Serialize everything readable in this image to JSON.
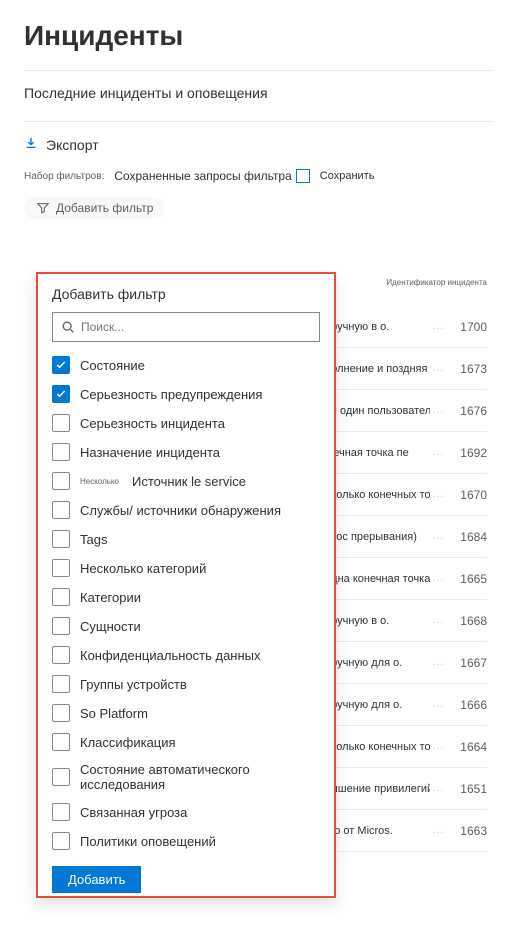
{
  "page": {
    "title": "Инциденты",
    "section": "Последние инциденты и оповещения",
    "export": "Экспорт",
    "filter_set_label": "Набор фильтров:",
    "saved_queries": "Сохраненные запросы фильтра",
    "save": "Сохранить",
    "add_filter": "Добавить фильтр"
  },
  "popup": {
    "title": "Добавить фильтр",
    "search_placeholder": "Поиск...",
    "add_button": "Добавить",
    "options": [
      {
        "label": "Состояние",
        "checked": true
      },
      {
        "label": "Серьезность предупреждения",
        "checked": true
      },
      {
        "label": "Серьезность инцидента",
        "checked": false
      },
      {
        "label": "Назначение инцидента",
        "checked": false
      },
      {
        "label": "Источник le service",
        "checked": false,
        "prefix": "Несколько"
      },
      {
        "label": "Службы/ источники обнаружения",
        "checked": false
      },
      {
        "label": "Tags",
        "checked": false
      },
      {
        "label": "Несколько категорий",
        "checked": false
      },
      {
        "label": "Категории",
        "checked": false
      },
      {
        "label": "Сущности",
        "checked": false
      },
      {
        "label": "Конфиденциальность данных",
        "checked": false
      },
      {
        "label": "Группы устройств",
        "checked": false
      },
      {
        "label": "So Platform",
        "checked": false
      },
      {
        "label": "Классификация",
        "checked": false
      },
      {
        "label": "Состояние автоматического исследования",
        "checked": false
      },
      {
        "label": "Связанная угроза",
        "checked": false
      },
      {
        "label": "Политики оповещений",
        "checked": false
      }
    ]
  },
  "table": {
    "id_header": "Идентификатор инцидента",
    "rows": [
      {
        "title": "ed вручную в о.",
        "id": "1700"
      },
      {
        "title": "Выполнение и поздняя",
        "id": "1673"
      },
      {
        "title": "Irving один пользователь",
        "id": "1676"
      },
      {
        "title": "оконечная точка пе",
        "id": "1692"
      },
      {
        "title": "rнесколько конечных точек",
        "id": "1670"
      },
      {
        "title": "tзапрос прерывания)",
        "id": "1684"
      },
      {
        "title": "on одна конечная точка",
        "id": "1665"
      },
      {
        "title": "ed вручную в о.",
        "id": "1668"
      },
      {
        "title": "ed вручную для о.",
        "id": "1667"
      },
      {
        "title": "ed вручную для о.",
        "id": "1666"
      },
      {
        "title": "rнесколько конечных точек",
        "id": "1664"
      },
      {
        "title": "Повышение привилегий",
        "id": "1651"
      },
      {
        "title": "олово от Micros.",
        "id": "1663"
      }
    ]
  }
}
